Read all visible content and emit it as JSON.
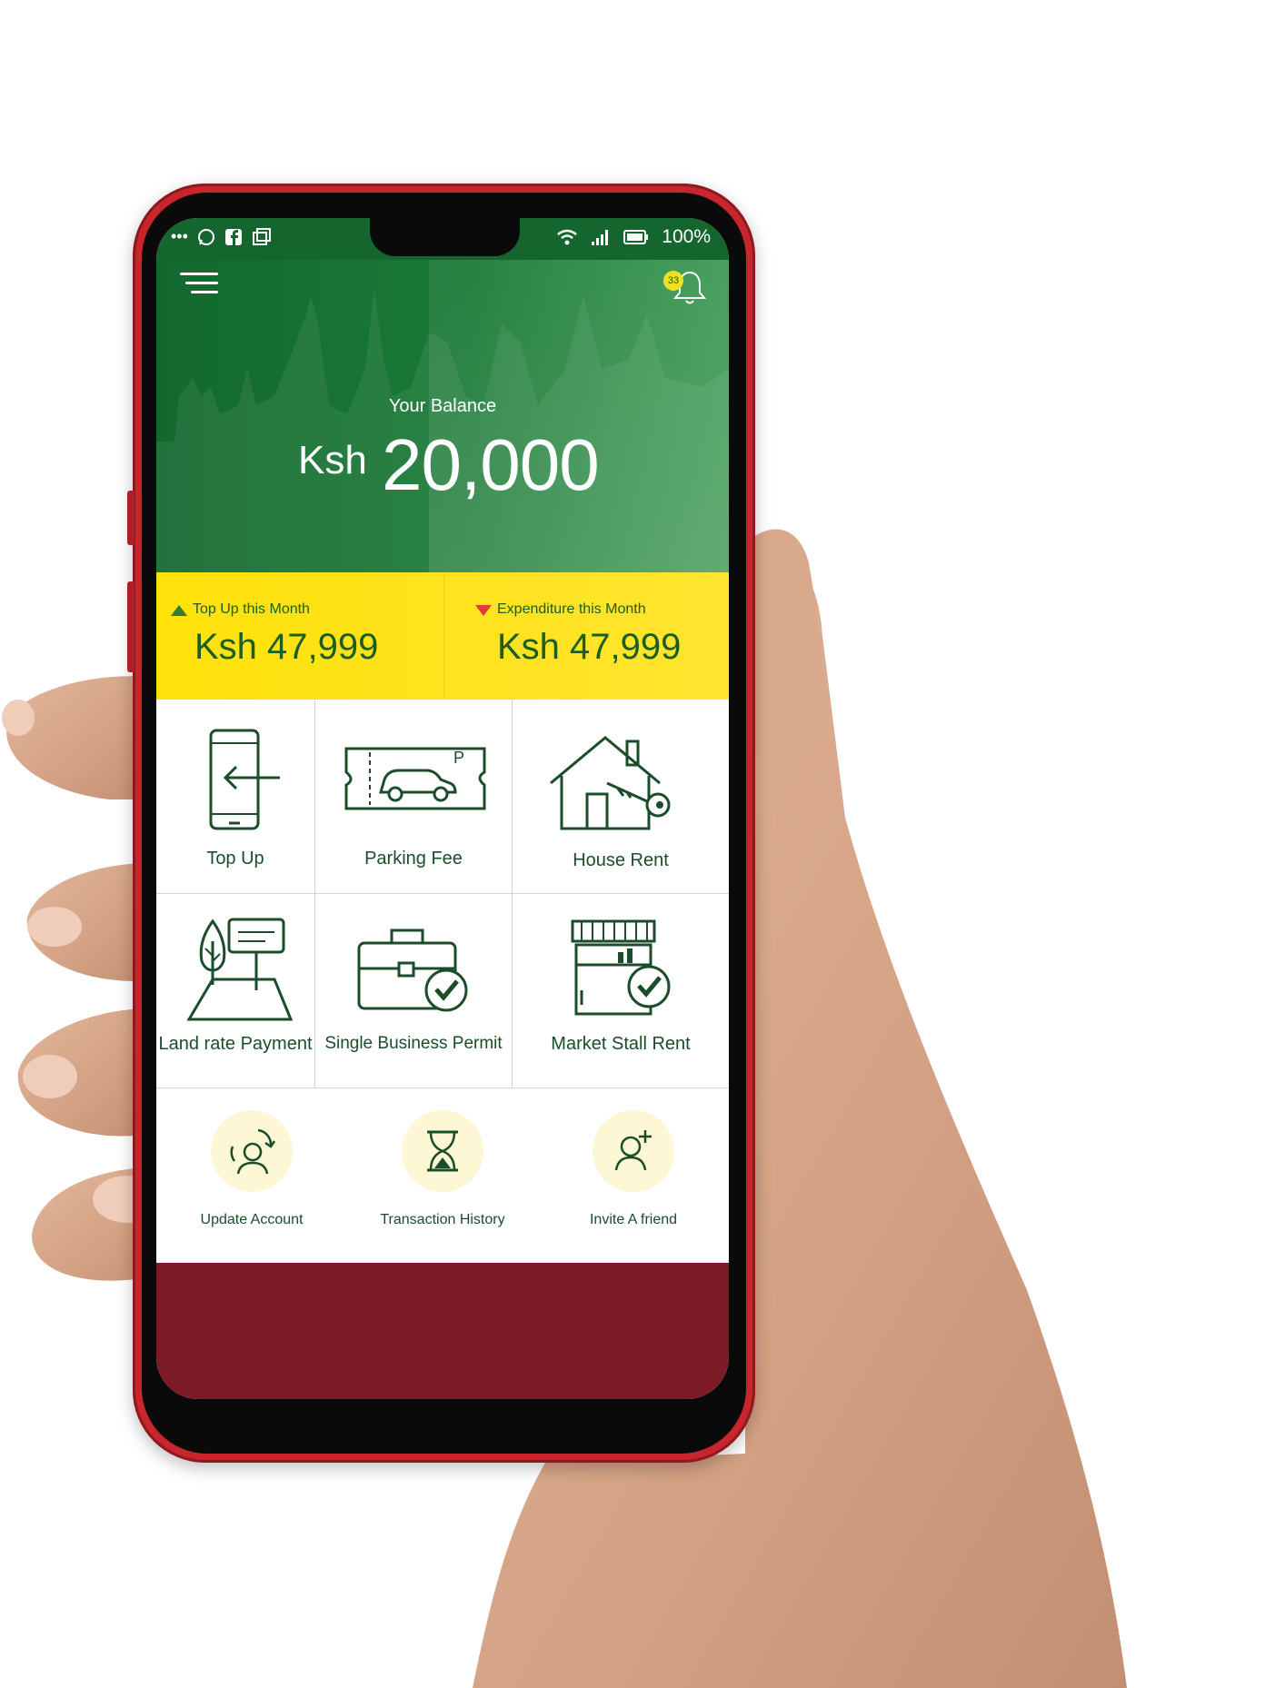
{
  "status_bar": {
    "left_icons": [
      "more-dots-icon",
      "whatsapp-icon",
      "facebook-icon",
      "gallery-icon"
    ],
    "battery": "100%"
  },
  "header": {
    "notification_count": "33",
    "balance_label": "Your Balance",
    "currency": "Ksh",
    "balance": "20,000"
  },
  "stats": {
    "topup": {
      "label": "Top Up this Month",
      "value": "Ksh 47,999"
    },
    "expenditure": {
      "label": "Expenditure this Month",
      "value": "Ksh 47,999"
    }
  },
  "services": [
    {
      "label": "Top Up",
      "icon": "phone-arrow-icon"
    },
    {
      "label": "Parking Fee",
      "icon": "parking-ticket-icon"
    },
    {
      "label": "House Rent",
      "icon": "house-key-icon"
    },
    {
      "label": "Land rate Payment",
      "icon": "land-sign-icon"
    },
    {
      "label": "Single Business Permit",
      "icon": "briefcase-check-icon"
    },
    {
      "label": "Market Stall Rent",
      "icon": "stall-check-icon"
    }
  ],
  "quick_actions": [
    {
      "label": "Update Account",
      "icon": "update-account-icon"
    },
    {
      "label": "Transaction History",
      "icon": "hourglass-icon"
    },
    {
      "label": "Invite A friend",
      "icon": "add-user-icon"
    }
  ],
  "colors": {
    "header_green": "#1a7a36",
    "stats_yellow": "#ffe20a",
    "footer_maroon": "#7d1a27",
    "phone_red": "#c8262c",
    "icon_green": "#1b4d2a"
  }
}
